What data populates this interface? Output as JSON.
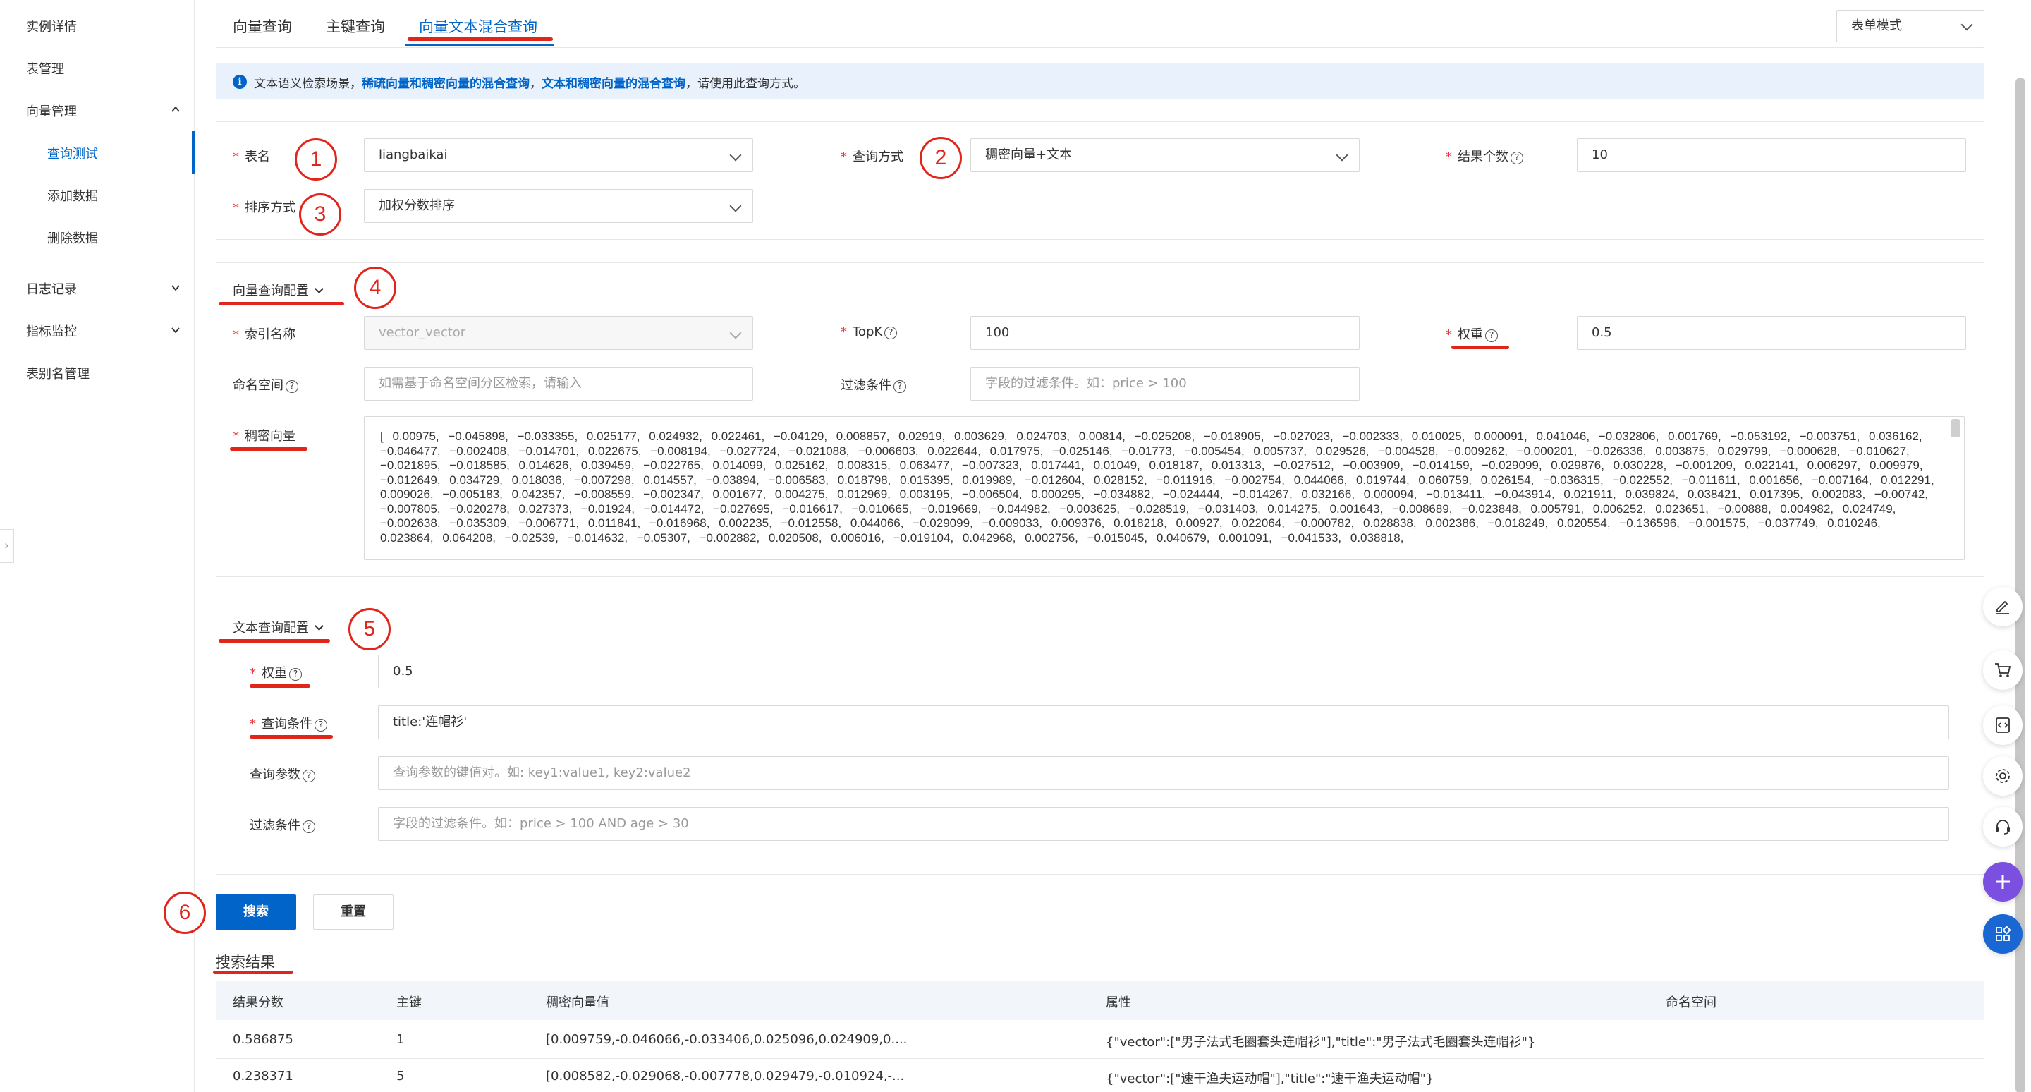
{
  "sidebar": {
    "items": [
      {
        "label": "实例详情"
      },
      {
        "label": "表管理"
      },
      {
        "label": "向量管理"
      },
      {
        "label": "查询测试"
      },
      {
        "label": "添加数据"
      },
      {
        "label": "删除数据"
      },
      {
        "label": "日志记录"
      },
      {
        "label": "指标监控"
      },
      {
        "label": "表别名管理"
      }
    ],
    "active": "查询测试"
  },
  "tabs": [
    {
      "label": "向量查询"
    },
    {
      "label": "主键查询"
    },
    {
      "label": "向量文本混合查询"
    }
  ],
  "mode_select": {
    "value": "表单模式"
  },
  "info": {
    "prefix": "文本语义检索场景，",
    "link1": "稀疏向量和稠密向量的混合查询",
    "sep": "，",
    "link2": "文本和稠密向量的混合查询",
    "suffix": "，请使用此查询方式。"
  },
  "basic": {
    "table_label": "表名",
    "table_value": "liangbaikai",
    "query_mode_label": "查询方式",
    "query_mode_value": "稠密向量+文本",
    "result_count_label": "结果个数",
    "result_count_value": "10",
    "sort_label": "排序方式",
    "sort_value": "加权分数排序"
  },
  "vector_config": {
    "title": "向量查询配置",
    "index_label": "索引名称",
    "index_value": "vector_vector",
    "topk_label": "TopK",
    "topk_value": "100",
    "weight_label": "权重",
    "weight_value": "0.5",
    "namespace_label": "命名空间",
    "namespace_placeholder": "如需基于命名空间分区检索，请输入",
    "filter_label": "过滤条件",
    "filter_placeholder": "字段的过滤条件。如：price > 100",
    "dense_label": "稠密向量",
    "dense_value": "[        0.00975,      −0.045898,          −0.033355,          0.025177,   0.024932,  0.022461,  −0.04129,  0.008857,  0.02919,      0.003629,  0.024703,  0.00814,      −0.025208,          −0.018905, −0.027023,          −0.002333,          0.010025,  0.000091,  0.041046, −0.032806,          0.001769,   −0.053192, −0.003751, 0.036162,   −0.046477,          −0.002408,         −0.014701,  0.022675,  −0.008194, −0.027724,          −0.021088, −0.006603,          0.022644,  0.017975,  −0.025146, −0.01773,  −0.005454,          0.005737, 0.029526,  −0.004528,          −0.009262,          −0.000201, −0.026336,          0.003875,  0.029799,  −0.000628,          −0.010627, −0.021895, −0.018585, 0.014626,  0.039459,  −0.022765,          0.014099,  0.025162,  0.008315,  0.063477,  −0.007323,          0.017441, 0.01049,     0.018187,   0.013313,   −0.027512, −0.003909,          −0.014159, −0.029099,          0.029876,  0.030228,  −0.001209, 0.022141,   0.006297,  0.009979,  −0.012649, 0.034729,  0.018036,  −0.007298,          0.014557,  −0.03894,  −0.006583,          0.018798, 0.015395,   0.019989,   −0.012604, 0.028152,   −0.011916,  −0.002754,          0.044066,  0.019744,  0.060759,  0.026154,  −0.036315, −0.022552,          −0.011611,  0.001656,  −0.007164, 0.012291,   0.009026,  −0.005183, 0.042357,  −0.008559,          −0.002347, 0.001677,   0.004275,   0.012969,   0.003195,   −0.006504,          0.000295,  −0.034882,          −0.024444,          −0.014267, 0.032166,  0.000094,  −0.013411,  −0.043914, 0.021911,   0.039824,  0.038421,  0.017395,  0.002083,  −0.00742,  −0.007805, −0.020278,          0.027373,  −0.01924,  −0.014472, −0.027695,          −0.016617,  −0.010665, −0.019669, −0.044982,          −0.003625,          −0.028519, −0.031403, 0.014275,  0.001643,  −0.008689,          −0.023848,          0.005791,  0.006252,  0.023651, −0.00888,   0.004982,   0.024749,   −0.002638,          −0.035309,          −0.006771,  0.011841,   −0.016968, 0.002235,  −0.012558, 0.044066,  −0.029099,          −0.009033,          0.009376,  0.018218,   0.00927,   0.022064,  −0.000782,          0.028838,  0.002386, −0.018249,  0.020554,  −0.136596, −0.001575, −0.037749,          0.010246,  0.023864,  0.064208,  −0.02539,  −0.014632, −0.05307,  −0.002882,          0.020508,  0.006016,   −0.019104,  0.042968,  0.002756,  −0.015045, 0.040679,  0.001091,   −0.041533, 0.038818,"
  },
  "text_config": {
    "title": "文本查询配置",
    "weight_label": "权重",
    "weight_value": "0.5",
    "query_label": "查询条件",
    "query_value": "title:'连帽衫'",
    "params_label": "查询参数",
    "params_placeholder": "查询参数的键值对。如: key1:value1, key2:value2",
    "filter_label": "过滤条件",
    "filter_placeholder": "字段的过滤条件。如：price > 100 AND age > 30"
  },
  "actions": {
    "search": "搜索",
    "reset": "重置"
  },
  "results": {
    "title": "搜索结果",
    "columns": [
      "结果分数",
      "主键",
      "稠密向量值",
      "属性",
      "命名空间"
    ],
    "rows": [
      {
        "score": "0.586875",
        "pk": "1",
        "dense": "[0.009759,-0.046066,-0.033406,0.025096,0.024909,0....",
        "attrs": "{\"vector\":[\"男子法式毛圈套头连帽衫\"],\"title\":\"男子法式毛圈套头连帽衫\"}",
        "ns": ""
      },
      {
        "score": "0.238371",
        "pk": "5",
        "dense": "[0.008582,-0.029068,-0.007778,0.029479,-0.010924,-...",
        "attrs": "{\"vector\":[\"速干渔夫运动帽\"],\"title\":\"速干渔夫运动帽\"}",
        "ns": ""
      }
    ]
  },
  "annotations": [
    "1",
    "2",
    "3",
    "4",
    "5",
    "6"
  ],
  "colors": {
    "accent": "#0064c8",
    "annotation": "#e1251b",
    "required": "#e4393c",
    "banner": "#e8f1fc",
    "table_header": "#f2f5f9"
  },
  "float_tools": [
    "edit-icon",
    "cart-icon",
    "code-doc-icon",
    "settings-icon",
    "support-icon",
    "plus-icon",
    "apps-icon"
  ]
}
